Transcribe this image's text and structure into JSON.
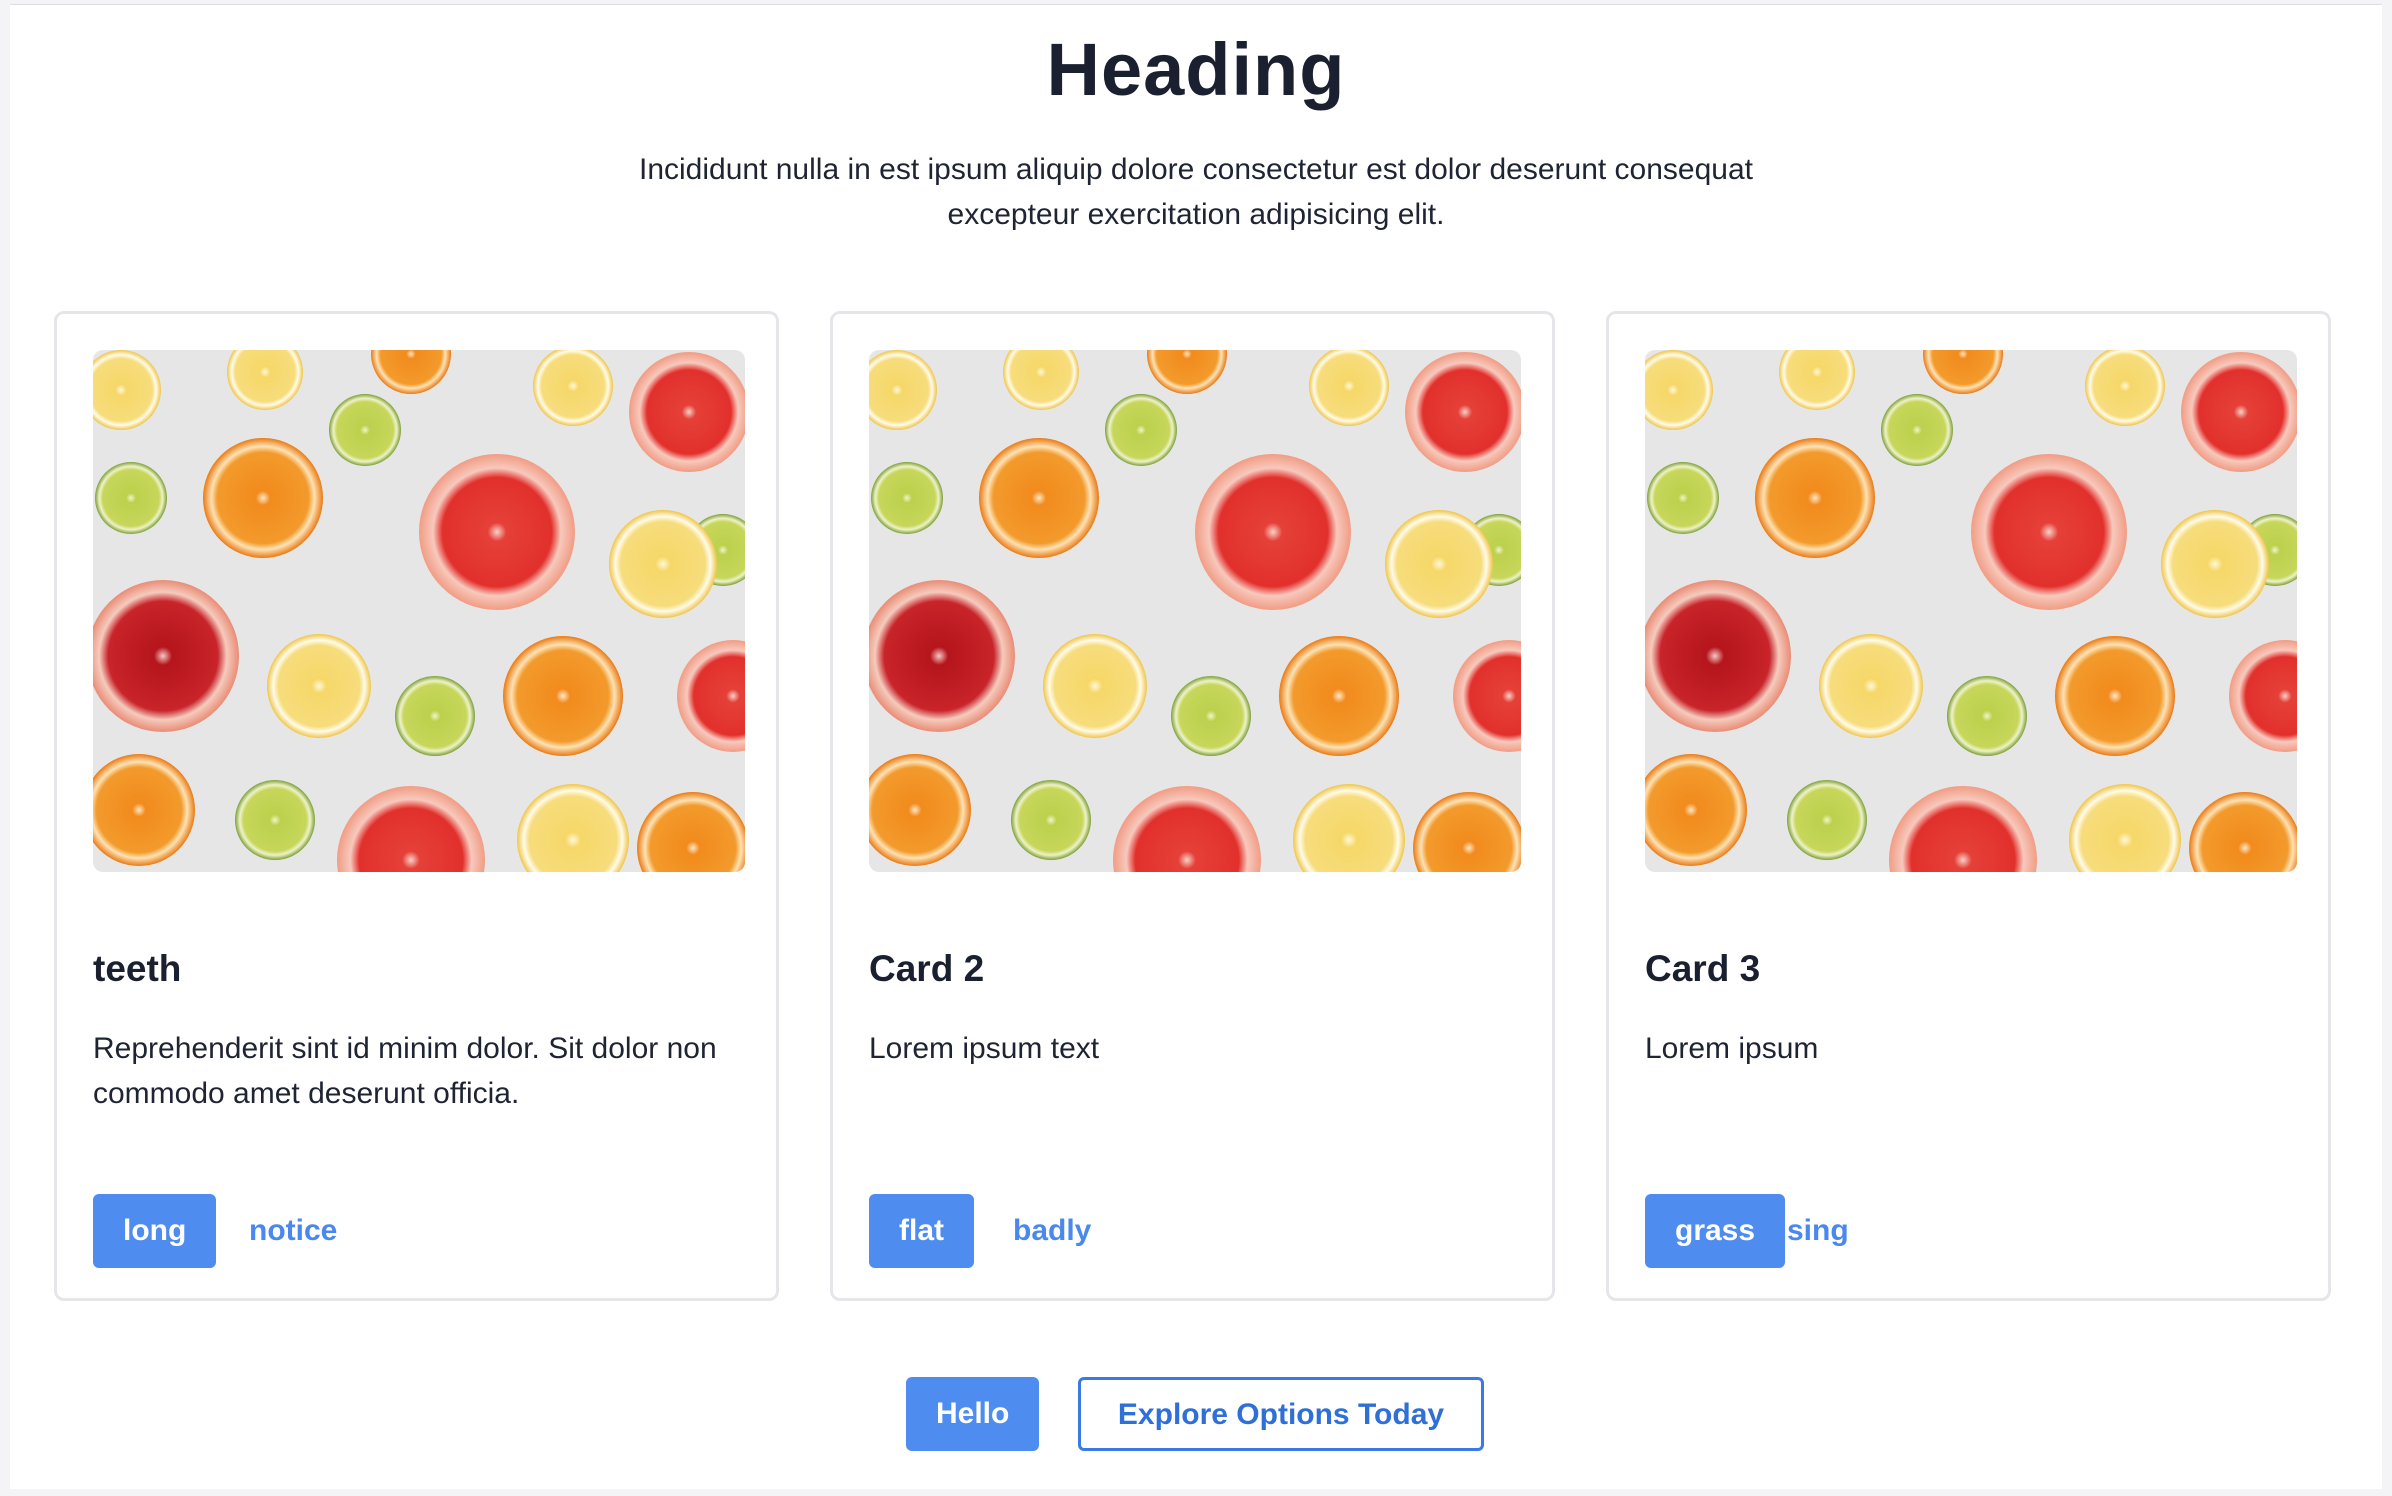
{
  "header": {
    "title": "Heading",
    "subtitle": "Incididunt nulla in est ipsum aliquip dolore consectetur est dolor deserunt consequat excepteur exercitation adipisicing elit."
  },
  "cards": [
    {
      "title": "teeth",
      "body": "Reprehenderit sint id minim dolor. Sit dolor non commodo amet deserunt officia.",
      "primary_label": "long",
      "secondary_label": "notice"
    },
    {
      "title": "Card 2",
      "body": "Lorem ipsum text",
      "primary_label": "flat",
      "secondary_label": "badly"
    },
    {
      "title": "Card 3",
      "body": "Lorem ipsum",
      "primary_label": "grass",
      "secondary_label": "sing"
    }
  ],
  "footer": {
    "primary_label": "Hello",
    "secondary_label": "Explore Options Today"
  },
  "colors": {
    "accent": "#4e8cf0",
    "link": "#4a88ee",
    "text": "#1a2030"
  }
}
